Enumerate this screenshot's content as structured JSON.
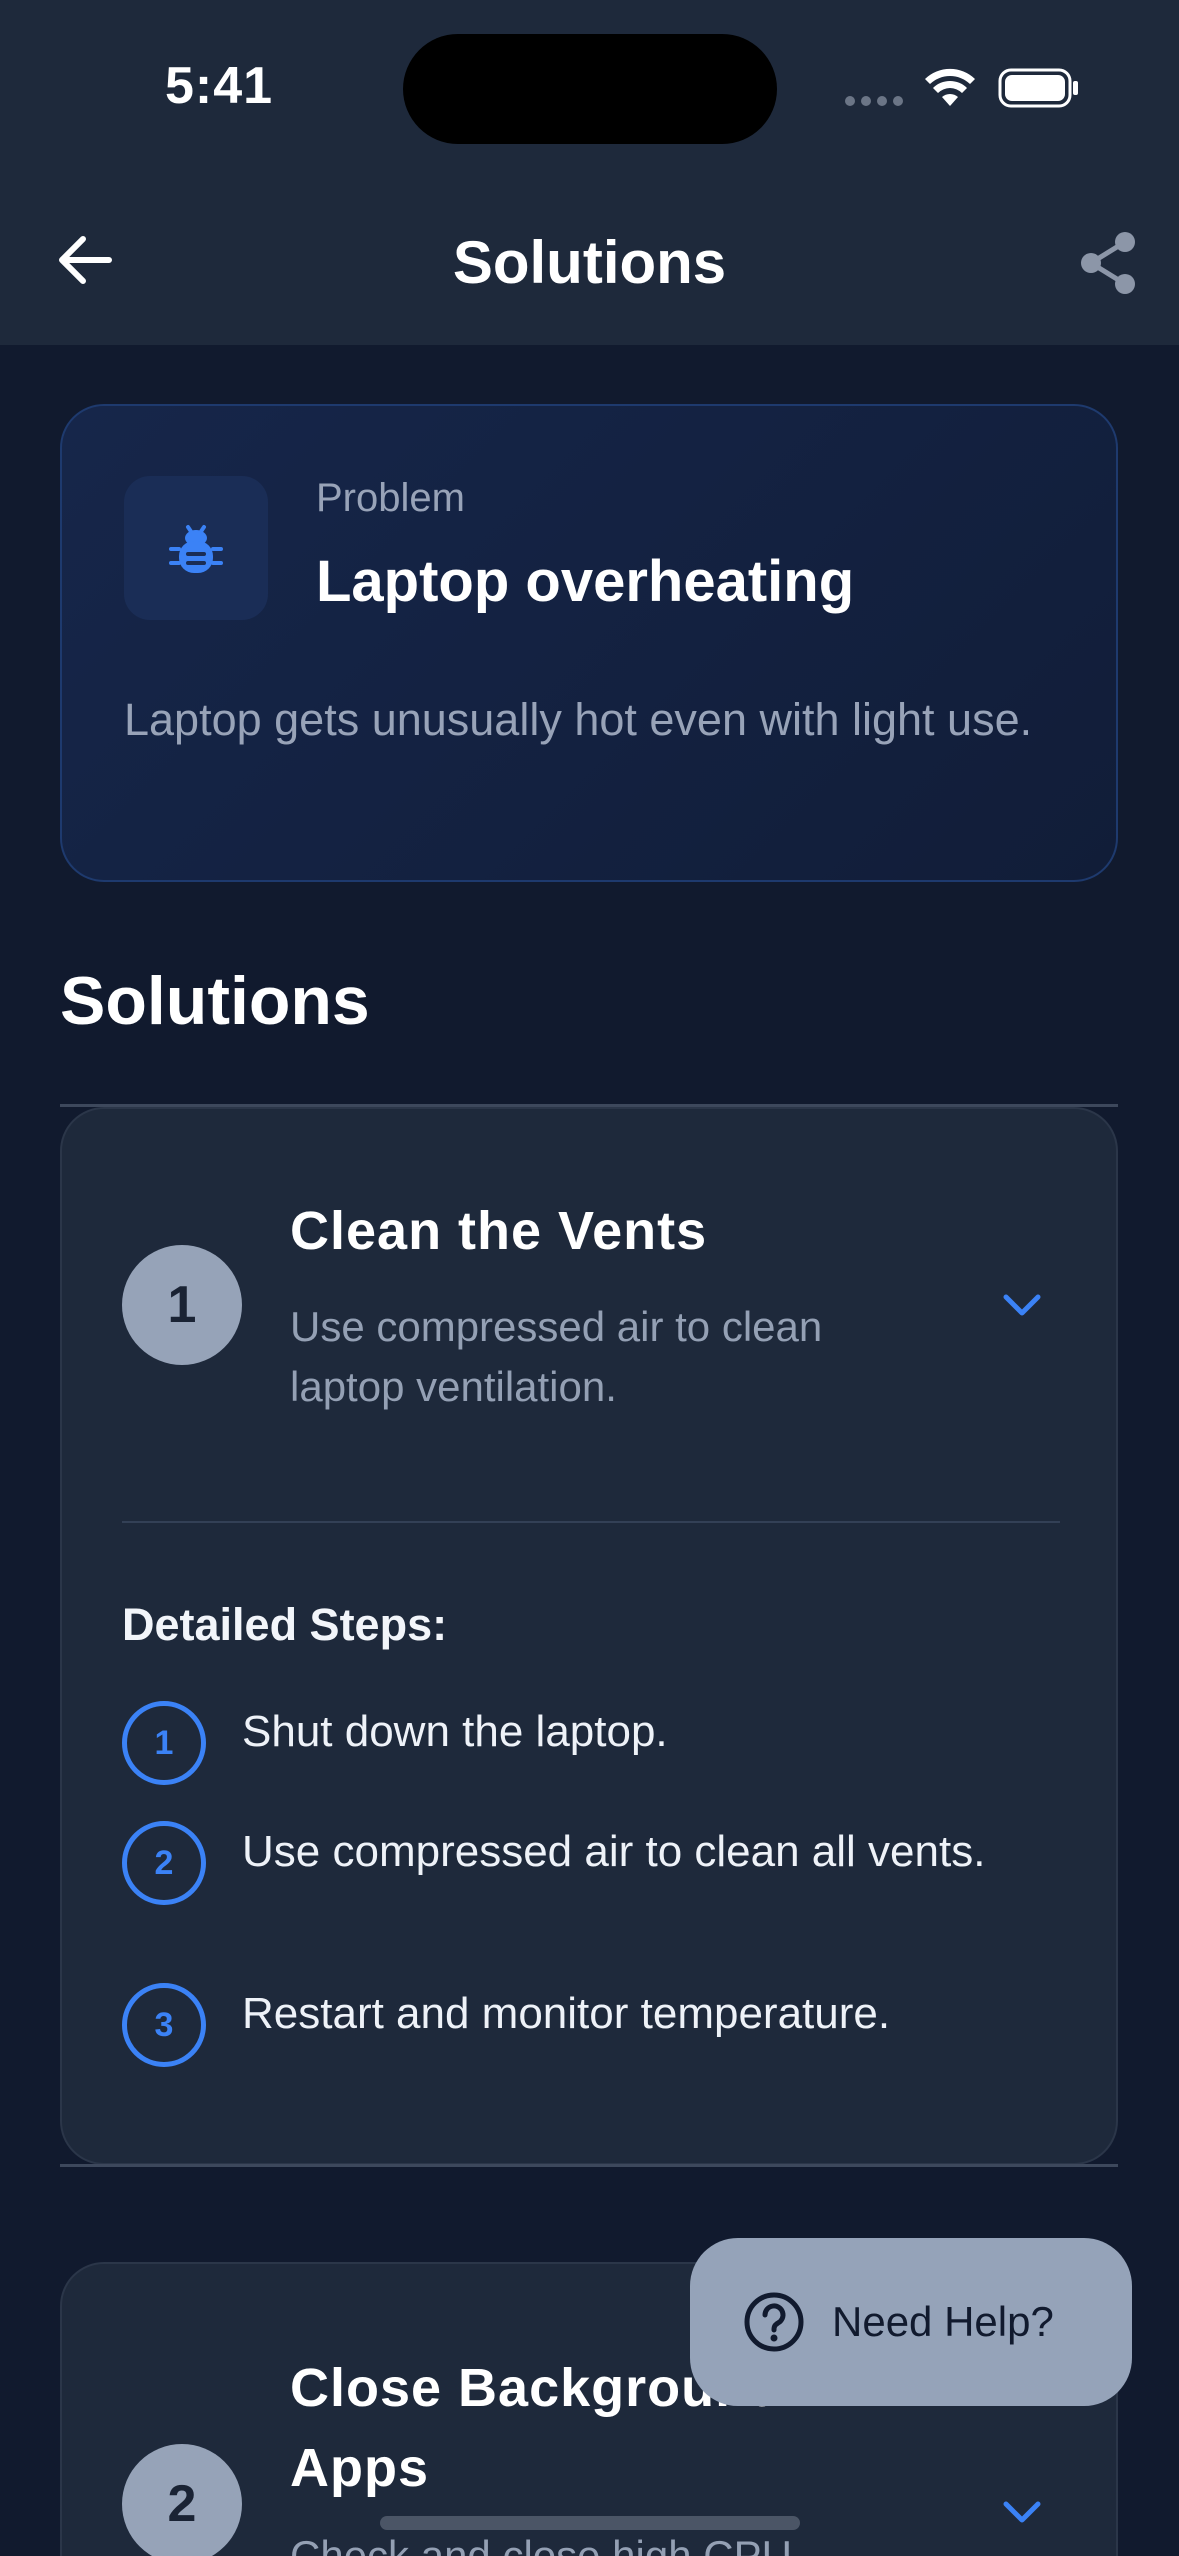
{
  "status_bar": {
    "time": "5:41"
  },
  "header": {
    "title": "Solutions",
    "back_icon": "arrow-left-icon",
    "share_icon": "share-icon"
  },
  "problem": {
    "icon": "bug-icon",
    "kicker": "Problem",
    "title": "Laptop overheating",
    "description": "Laptop gets unusually hot even with light use."
  },
  "solutions_section": {
    "title": "Solutions",
    "items": [
      {
        "number": "1",
        "title": "Clean the Vents",
        "description": "Use compressed air to clean laptop ventilation.",
        "expanded": true,
        "steps_heading": "Detailed Steps:",
        "steps": [
          {
            "number": "1",
            "text": "Shut down the laptop."
          },
          {
            "number": "2",
            "text": "Use compressed air to clean all vents."
          },
          {
            "number": "3",
            "text": "Restart and monitor temperature."
          }
        ]
      },
      {
        "number": "2",
        "title": "Close Background Apps",
        "description": "Check and close high CPU",
        "expanded": false
      }
    ]
  },
  "help_button": {
    "label": "Need Help?",
    "icon": "question-circle-icon"
  },
  "colors": {
    "background": "#111a2e",
    "header": "#1e293b",
    "card": "#1e293b",
    "accent": "#3b82f6",
    "muted_text": "#98a3b8",
    "number_circle": "#96a3b8"
  }
}
